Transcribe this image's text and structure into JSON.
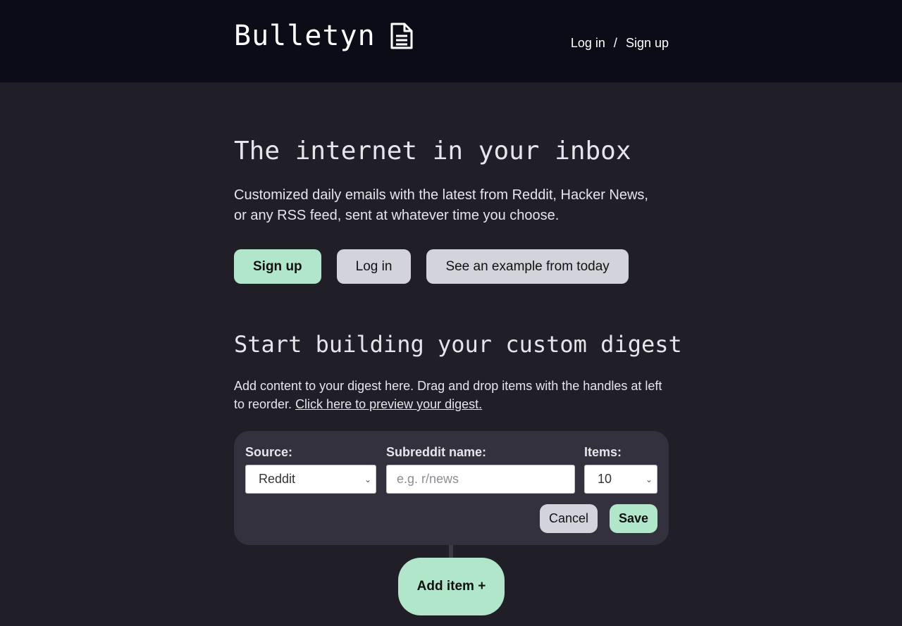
{
  "header": {
    "brand": "Bulletyn",
    "brand_icon": "document-icon",
    "login_label": "Log in",
    "separator": "/",
    "signup_label": "Sign up"
  },
  "hero": {
    "title": "The internet in your inbox",
    "description": "Customized daily emails with the latest from Reddit, Hacker News, or any RSS feed, sent at whatever time you choose.",
    "buttons": {
      "signup": "Sign up",
      "login": "Log in",
      "example": "See an example from today"
    }
  },
  "builder": {
    "title": "Start building your custom digest",
    "description": "Add content to your digest here. Drag and drop items with the handles at left to reorder.",
    "preview_link": "Click here to preview your digest.",
    "card": {
      "source_label": "Source:",
      "source_value": "Reddit",
      "subreddit_label": "Subreddit name:",
      "subreddit_placeholder": "e.g. r/news",
      "items_label": "Items:",
      "items_value": "10",
      "cancel_label": "Cancel",
      "save_label": "Save"
    },
    "add_item_label": "Add item +"
  },
  "colors": {
    "header_bg": "#0c0c19",
    "page_bg": "#201f27",
    "card_bg": "#32313d",
    "accent_green": "#b2e6ca",
    "button_grey": "#d3d4db"
  }
}
